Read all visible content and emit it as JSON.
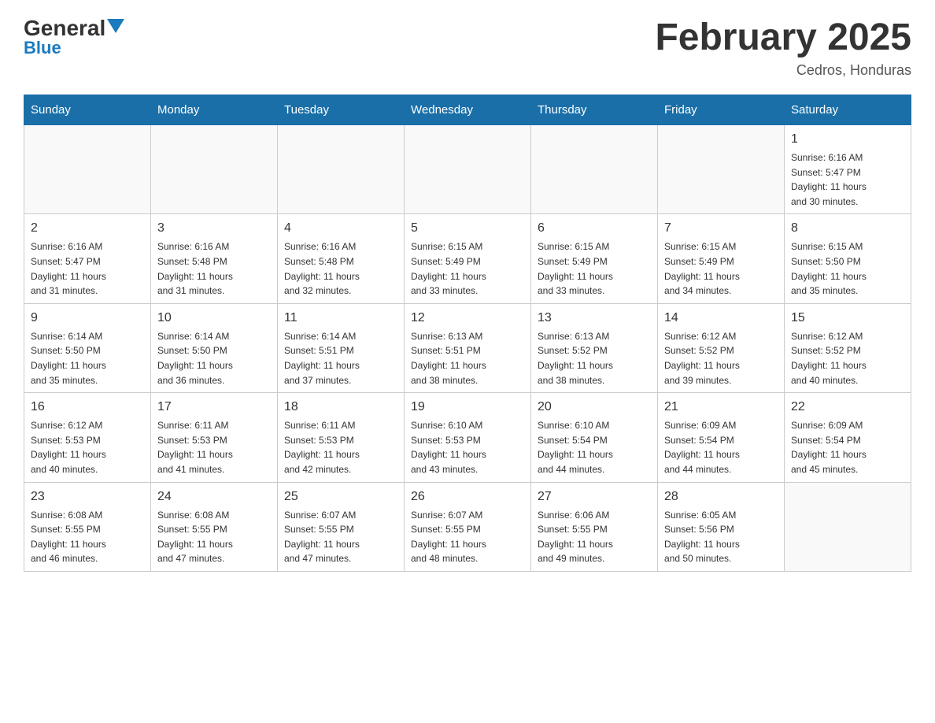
{
  "header": {
    "logo_general": "General",
    "logo_blue": "Blue",
    "month_title": "February 2025",
    "location": "Cedros, Honduras"
  },
  "days_of_week": [
    "Sunday",
    "Monday",
    "Tuesday",
    "Wednesday",
    "Thursday",
    "Friday",
    "Saturday"
  ],
  "weeks": [
    [
      {
        "day": "",
        "info": ""
      },
      {
        "day": "",
        "info": ""
      },
      {
        "day": "",
        "info": ""
      },
      {
        "day": "",
        "info": ""
      },
      {
        "day": "",
        "info": ""
      },
      {
        "day": "",
        "info": ""
      },
      {
        "day": "1",
        "info": "Sunrise: 6:16 AM\nSunset: 5:47 PM\nDaylight: 11 hours\nand 30 minutes."
      }
    ],
    [
      {
        "day": "2",
        "info": "Sunrise: 6:16 AM\nSunset: 5:47 PM\nDaylight: 11 hours\nand 31 minutes."
      },
      {
        "day": "3",
        "info": "Sunrise: 6:16 AM\nSunset: 5:48 PM\nDaylight: 11 hours\nand 31 minutes."
      },
      {
        "day": "4",
        "info": "Sunrise: 6:16 AM\nSunset: 5:48 PM\nDaylight: 11 hours\nand 32 minutes."
      },
      {
        "day": "5",
        "info": "Sunrise: 6:15 AM\nSunset: 5:49 PM\nDaylight: 11 hours\nand 33 minutes."
      },
      {
        "day": "6",
        "info": "Sunrise: 6:15 AM\nSunset: 5:49 PM\nDaylight: 11 hours\nand 33 minutes."
      },
      {
        "day": "7",
        "info": "Sunrise: 6:15 AM\nSunset: 5:49 PM\nDaylight: 11 hours\nand 34 minutes."
      },
      {
        "day": "8",
        "info": "Sunrise: 6:15 AM\nSunset: 5:50 PM\nDaylight: 11 hours\nand 35 minutes."
      }
    ],
    [
      {
        "day": "9",
        "info": "Sunrise: 6:14 AM\nSunset: 5:50 PM\nDaylight: 11 hours\nand 35 minutes."
      },
      {
        "day": "10",
        "info": "Sunrise: 6:14 AM\nSunset: 5:50 PM\nDaylight: 11 hours\nand 36 minutes."
      },
      {
        "day": "11",
        "info": "Sunrise: 6:14 AM\nSunset: 5:51 PM\nDaylight: 11 hours\nand 37 minutes."
      },
      {
        "day": "12",
        "info": "Sunrise: 6:13 AM\nSunset: 5:51 PM\nDaylight: 11 hours\nand 38 minutes."
      },
      {
        "day": "13",
        "info": "Sunrise: 6:13 AM\nSunset: 5:52 PM\nDaylight: 11 hours\nand 38 minutes."
      },
      {
        "day": "14",
        "info": "Sunrise: 6:12 AM\nSunset: 5:52 PM\nDaylight: 11 hours\nand 39 minutes."
      },
      {
        "day": "15",
        "info": "Sunrise: 6:12 AM\nSunset: 5:52 PM\nDaylight: 11 hours\nand 40 minutes."
      }
    ],
    [
      {
        "day": "16",
        "info": "Sunrise: 6:12 AM\nSunset: 5:53 PM\nDaylight: 11 hours\nand 40 minutes."
      },
      {
        "day": "17",
        "info": "Sunrise: 6:11 AM\nSunset: 5:53 PM\nDaylight: 11 hours\nand 41 minutes."
      },
      {
        "day": "18",
        "info": "Sunrise: 6:11 AM\nSunset: 5:53 PM\nDaylight: 11 hours\nand 42 minutes."
      },
      {
        "day": "19",
        "info": "Sunrise: 6:10 AM\nSunset: 5:53 PM\nDaylight: 11 hours\nand 43 minutes."
      },
      {
        "day": "20",
        "info": "Sunrise: 6:10 AM\nSunset: 5:54 PM\nDaylight: 11 hours\nand 44 minutes."
      },
      {
        "day": "21",
        "info": "Sunrise: 6:09 AM\nSunset: 5:54 PM\nDaylight: 11 hours\nand 44 minutes."
      },
      {
        "day": "22",
        "info": "Sunrise: 6:09 AM\nSunset: 5:54 PM\nDaylight: 11 hours\nand 45 minutes."
      }
    ],
    [
      {
        "day": "23",
        "info": "Sunrise: 6:08 AM\nSunset: 5:55 PM\nDaylight: 11 hours\nand 46 minutes."
      },
      {
        "day": "24",
        "info": "Sunrise: 6:08 AM\nSunset: 5:55 PM\nDaylight: 11 hours\nand 47 minutes."
      },
      {
        "day": "25",
        "info": "Sunrise: 6:07 AM\nSunset: 5:55 PM\nDaylight: 11 hours\nand 47 minutes."
      },
      {
        "day": "26",
        "info": "Sunrise: 6:07 AM\nSunset: 5:55 PM\nDaylight: 11 hours\nand 48 minutes."
      },
      {
        "day": "27",
        "info": "Sunrise: 6:06 AM\nSunset: 5:55 PM\nDaylight: 11 hours\nand 49 minutes."
      },
      {
        "day": "28",
        "info": "Sunrise: 6:05 AM\nSunset: 5:56 PM\nDaylight: 11 hours\nand 50 minutes."
      },
      {
        "day": "",
        "info": ""
      }
    ]
  ]
}
